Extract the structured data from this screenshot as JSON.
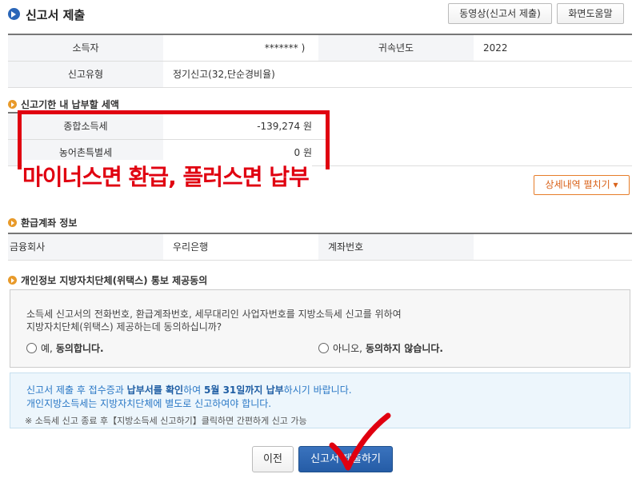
{
  "header": {
    "title": "신고서 제출",
    "video_button": "동영상(신고서 제출)",
    "help_button": "화면도움말"
  },
  "summary": {
    "taxpayer_label": "소득자",
    "taxpayer_value": "*******   )",
    "year_label": "귀속년도",
    "year_value": "2022",
    "type_label": "신고유형",
    "type_value": "정기신고(32,단순경비율)"
  },
  "tax_section": {
    "title": "신고기한 내 납부할 세액",
    "rows": [
      {
        "label": "종합소득세",
        "amount": "-139,274 원"
      },
      {
        "label": "농어촌특별세",
        "amount": "0 원"
      }
    ]
  },
  "annotation": {
    "text": "마이너스면 환급, 플러스면 납부",
    "color": "#e00010"
  },
  "detail_button": "상세내역 펼치기 ▾",
  "refund_section": {
    "title": "환급계좌 정보",
    "bank_label": "금융회사",
    "bank_value": "우리은행",
    "account_label": "계좌번호",
    "account_value": ""
  },
  "consent_section": {
    "title": "개인정보 지방자치단체(위택스) 통보 제공동의",
    "question_line1": "소득세 신고서의 전화번호, 환급계좌번호, 세무대리인 사업자번호를 지방소득세 신고를 위하여",
    "question_line2": "지방자치단체(위택스) 제공하는데 동의하십니까?",
    "yes_prefix": "예,",
    "yes_bold": "동의합니다.",
    "no_prefix": "아니오,",
    "no_bold": "동의하지 않습니다."
  },
  "notice": {
    "l1_a": "신고서 제출 후 접수증과 ",
    "l1_b": "납부서를 확인",
    "l1_c": "하여 ",
    "l1_d": "5월 31일까지 납부",
    "l1_e": "하시기 바랍니다.",
    "line2": "개인지방소득세는 지방자치단체에 별도로 신고하여야 합니다.",
    "line3": "※ 소득세 신고 종료 후【지방소득세 신고하기】클릭하면 간편하게 신고 가능"
  },
  "buttons": {
    "prev": "이전",
    "submit": "신고서 제출하기"
  },
  "colors": {
    "accent": "#2a66b8",
    "orange": "#e89a2a",
    "annotation_red": "#e00010"
  }
}
